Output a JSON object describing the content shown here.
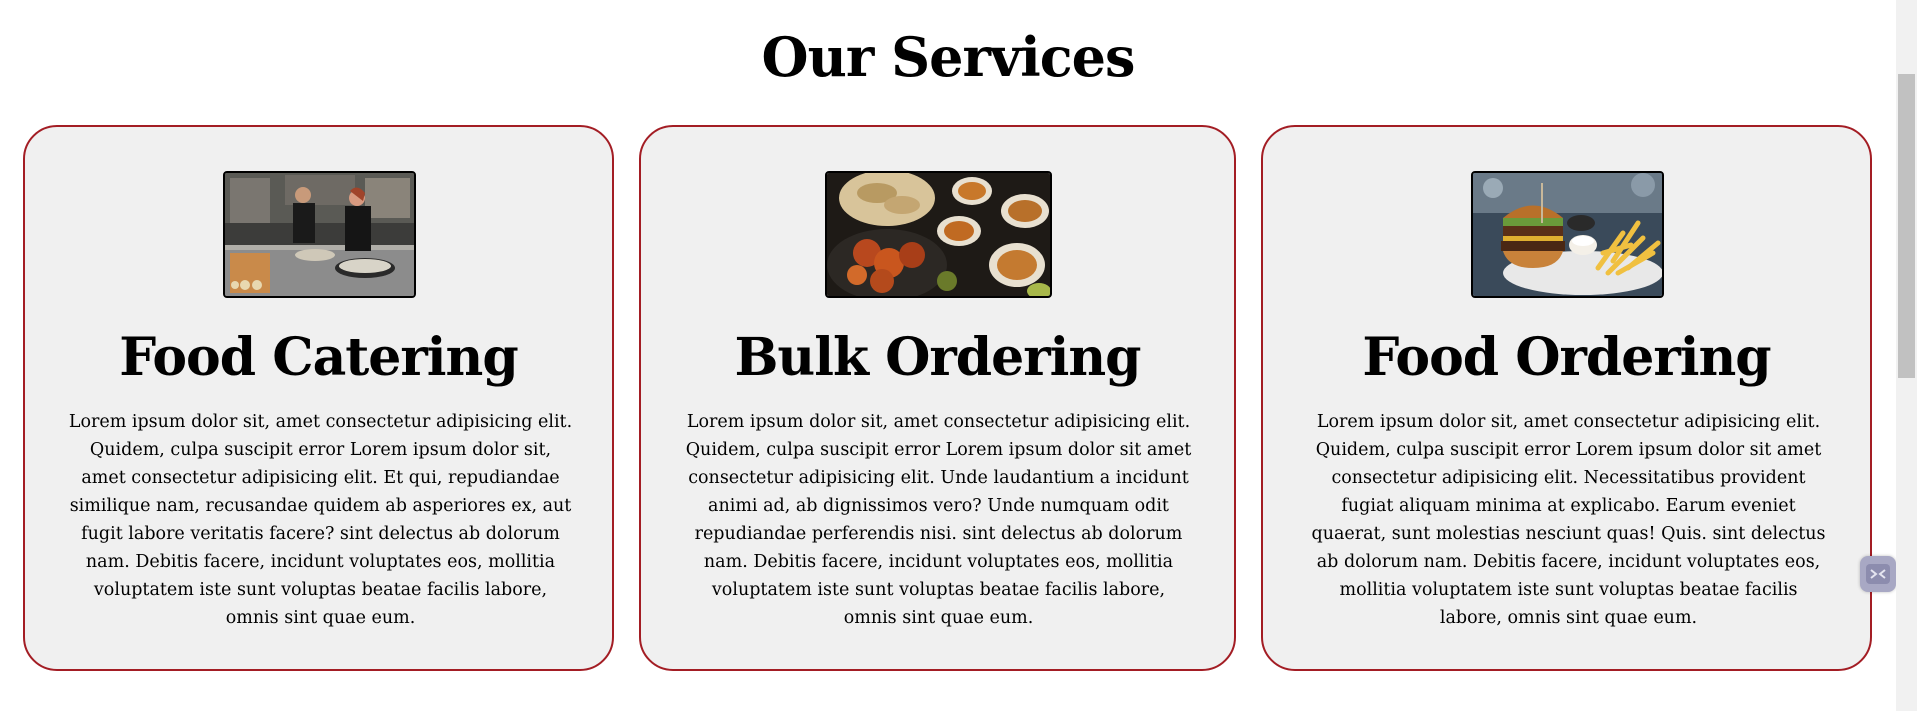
{
  "section": {
    "title": "Our Services"
  },
  "cards": [
    {
      "title": "Food Catering",
      "image_alt": "chefs preparing food in a kitchen",
      "text": "Lorem ipsum dolor sit, amet consectetur adipisicing elit. Quidem, culpa suscipit error Lorem ipsum dolor sit, amet consectetur adipisicing elit. Et qui, repudiandae similique nam, recusandae quidem ab asperiores ex, aut fugit labore veritatis facere? sint delectus ab dolorum nam. Debitis facere, incidunt voluptates eos, mollitia voluptatem iste sunt voluptas beatae facilis labore, omnis sint quae eum."
    },
    {
      "title": "Bulk Ordering",
      "image_alt": "table with curries, naan and fried chicken",
      "text": "Lorem ipsum dolor sit, amet consectetur adipisicing elit. Quidem, culpa suscipit error Lorem ipsum dolor sit amet consectetur adipisicing elit. Unde laudantium a incidunt animi ad, ab dignissimos vero? Unde numquam odit repudiandae perferendis nisi. sint delectus ab dolorum nam. Debitis facere, incidunt voluptates eos, mollitia voluptatem iste sunt voluptas beatae facilis labore, omnis sint quae eum."
    },
    {
      "title": "Food Ordering",
      "image_alt": "burger with fries and dip",
      "text": "Lorem ipsum dolor sit, amet consectetur adipisicing elit. Quidem, culpa suscipit error Lorem ipsum dolor sit amet consectetur adipisicing elit. Necessitatibus provident fugiat aliquam minima at explicabo. Earum eveniet quaerat, sunt molestias nesciunt quas! Quis. sint delectus ab dolorum nam. Debitis facere, incidunt voluptates eos, mollitia voluptatem iste sunt voluptas beatae facilis labore, omnis sint quae eum."
    }
  ],
  "colors": {
    "card_border": "#a31d24",
    "card_background": "#f0f0f0",
    "scrollbar_track": "#f1f1f1",
    "scrollbar_thumb": "#c1c1c1"
  },
  "icons": {
    "floating_widget": "chat-widget-icon"
  }
}
